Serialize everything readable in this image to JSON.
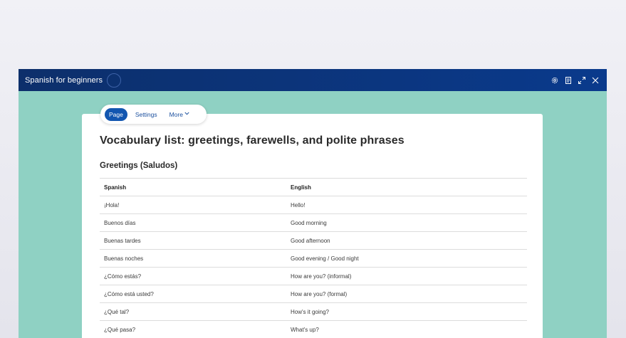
{
  "app": {
    "title": "Spanish for beginners"
  },
  "titlebar_icons": [
    "gear-icon",
    "document-icon",
    "expand-icon",
    "close-icon"
  ],
  "nav": {
    "tabs": [
      {
        "label": "Page",
        "active": true
      },
      {
        "label": "Settings",
        "active": false
      },
      {
        "label": "More",
        "active": false,
        "has_dropdown": true
      }
    ]
  },
  "content": {
    "page_title": "Vocabulary list: greetings, farewells, and polite phrases",
    "section_title": "Greetings (Saludos)",
    "table": {
      "headers": [
        "Spanish",
        "English"
      ],
      "rows": [
        [
          "¡Hola!",
          "Hello!"
        ],
        [
          "Buenos días",
          "Good morning"
        ],
        [
          "Buenas tardes",
          "Good afternoon"
        ],
        [
          "Buenas noches",
          "Good evening / Good night"
        ],
        [
          "¿Cómo estás?",
          "How are you? (informal)"
        ],
        [
          "¿Cómo está usted?",
          "How are you? (formal)"
        ],
        [
          "¿Qué tal?",
          "How's it going?"
        ],
        [
          "¿Qué pasa?",
          "What's up?"
        ]
      ]
    }
  },
  "colors": {
    "titlebar": "#0a3a8c",
    "canvas": "#8fd1c3",
    "accent": "#1256b0"
  }
}
